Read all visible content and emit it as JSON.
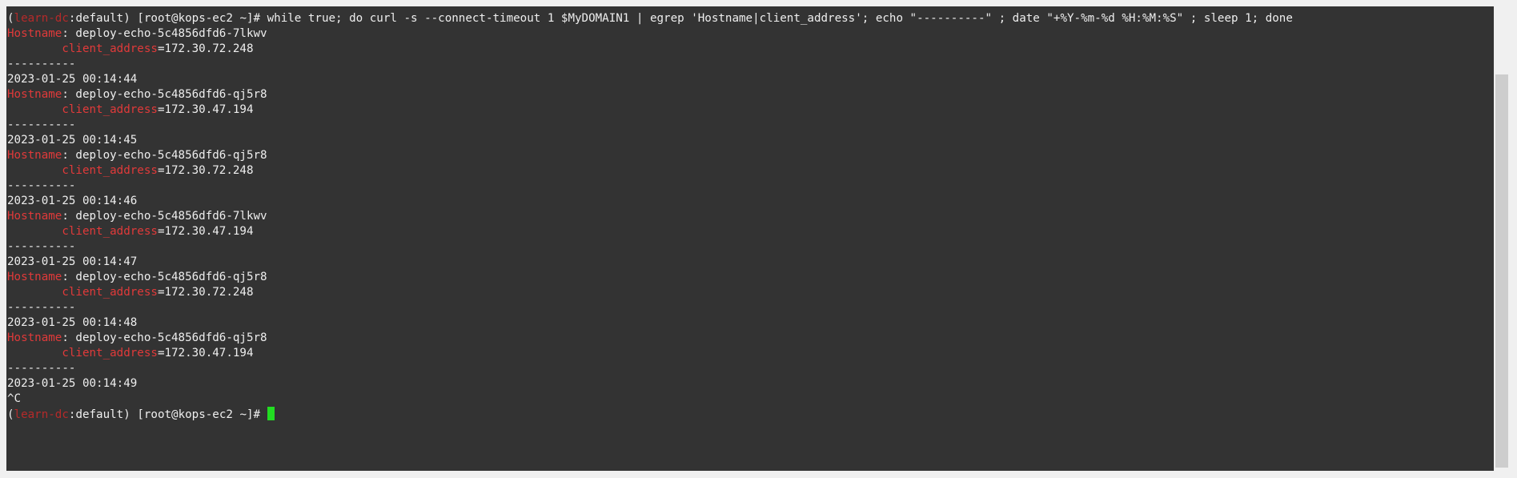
{
  "terminal": {
    "prompt": {
      "open_paren": "(",
      "context": "learn-dc",
      "namespace_sep": ":",
      "namespace": "default",
      "close_paren": ")",
      "user_host": " [root@kops-ec2 ~]# "
    },
    "command": "while true; do curl -s --connect-timeout 1 $MyDOMAIN1 | egrep 'Hostname|client_address'; echo \"----------\" ; date \"+%Y-%m-%d %H:%M:%S\" ; sleep 1; done",
    "hostname_key": "Hostname",
    "client_key": "client_address",
    "separator": "----------",
    "ctrl_c": "^C",
    "output": [
      {
        "hostname": ": deploy-echo-5c4856dfd6-7lkwv",
        "client": "=172.30.72.248",
        "timestamp": "2023-01-25 00:14:44"
      },
      {
        "hostname": ": deploy-echo-5c4856dfd6-qj5r8",
        "client": "=172.30.47.194",
        "timestamp": "2023-01-25 00:14:45"
      },
      {
        "hostname": ": deploy-echo-5c4856dfd6-qj5r8",
        "client": "=172.30.72.248",
        "timestamp": "2023-01-25 00:14:46"
      },
      {
        "hostname": ": deploy-echo-5c4856dfd6-7lkwv",
        "client": "=172.30.47.194",
        "timestamp": "2023-01-25 00:14:47"
      },
      {
        "hostname": ": deploy-echo-5c4856dfd6-qj5r8",
        "client": "=172.30.72.248",
        "timestamp": "2023-01-25 00:14:48"
      },
      {
        "hostname": ": deploy-echo-5c4856dfd6-qj5r8",
        "client": "=172.30.47.194",
        "timestamp": "2023-01-25 00:14:49"
      }
    ]
  },
  "colors": {
    "background": "#333333",
    "text": "#eeeeee",
    "key_red": "#e03a3a",
    "cursor_green": "#22dd22"
  }
}
